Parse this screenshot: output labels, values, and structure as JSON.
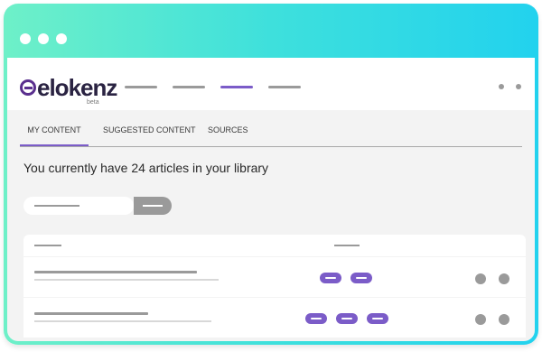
{
  "window": {
    "controls": [
      "close",
      "minimize",
      "maximize"
    ]
  },
  "app": {
    "logo_text": "elokenz",
    "logo_badge": "beta",
    "logo_icon": "speech-bubble-icon"
  },
  "header": {
    "nav_placeholders": 4,
    "active_nav_index": 2
  },
  "tabs": [
    {
      "label": "MY CONTENT",
      "active": true
    },
    {
      "label": "SUGGESTED CONTENT",
      "active": false
    },
    {
      "label": "SOURCES",
      "active": false
    }
  ],
  "main": {
    "headline": "You currently have 24 articles in your library"
  },
  "table": {
    "rows": [
      {
        "tag_count": 2,
        "actions": 2
      },
      {
        "tag_count": 3,
        "actions": 2
      }
    ]
  },
  "colors": {
    "accent": "#7b5cc8",
    "brand": "#2a2342",
    "placeholder": "#9a9a9a",
    "gradient_start": "#6ef0c8",
    "gradient_end": "#22d2ee"
  }
}
